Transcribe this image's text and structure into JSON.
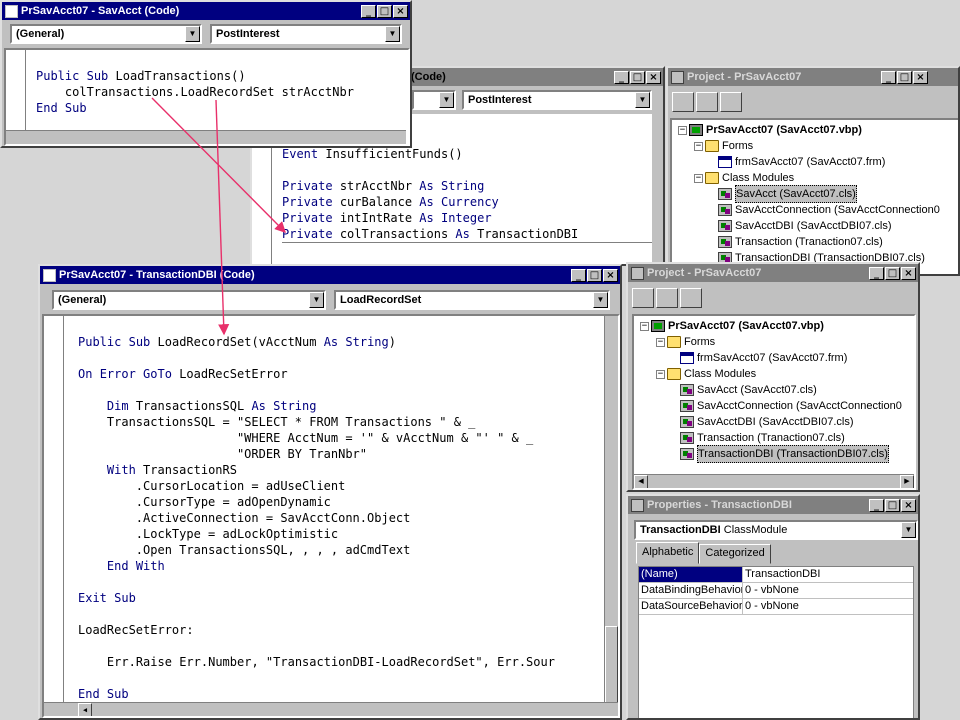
{
  "top_code_window": {
    "title": "PrSavAcct07 - SavAcct (Code)",
    "object_combo": "(General)",
    "proc_combo": "PostInterest",
    "lines": [
      "Public Sub LoadTransactions()",
      "    colTransactions.LoadRecordSet strAcctNbr",
      "End Sub"
    ]
  },
  "mid_code_window": {
    "title": "(Code)",
    "object_combo": "",
    "proc_combo": "PostInterest",
    "lines": [
      "Event InsufficientFunds()",
      "",
      "Private strAcctNbr As String",
      "Private curBalance As Currency",
      "Private intIntRate As Integer",
      "Private colTransactions As TransactionDBI"
    ]
  },
  "main_code_window": {
    "title": "PrSavAcct07 - TransactionDBI (Code)",
    "object_combo": "(General)",
    "proc_combo": "LoadRecordSet",
    "lines": [
      "Public Sub LoadRecordSet(vAcctNum As String)",
      "",
      "On Error GoTo LoadRecSetError",
      "",
      "    Dim TransactionsSQL As String",
      "    TransactionsSQL = \"SELECT * FROM Transactions \" & _",
      "                      \"WHERE AcctNum = '\" & vAcctNum & \"' \" & _",
      "                      \"ORDER BY TranNbr\"",
      "    With TransactionRS",
      "        .CursorLocation = adUseClient",
      "        .CursorType = adOpenDynamic",
      "        .ActiveConnection = SavAcctConn.Object",
      "        .LockType = adLockOptimistic",
      "        .Open TransactionsSQL, , , , adCmdText",
      "    End With",
      "",
      "Exit Sub",
      "",
      "LoadRecSetError:",
      "",
      "    Err.Raise Err.Number, \"TransactionDBI-LoadRecordSet\", Err.Sour",
      "",
      "End Sub"
    ]
  },
  "project_top": {
    "title": "Project - PrSavAcct07",
    "root": "PrSavAcct07 (SavAcct07.vbp)",
    "forms_label": "Forms",
    "form_item": "frmSavAcct07 (SavAcct07.frm)",
    "classes_label": "Class Modules",
    "class_items": [
      "SavAcct (SavAcct07.cls)",
      "SavAcctConnection (SavAcctConnection0",
      "SavAcctDBI (SavAcctDBI07.cls)",
      "Transaction (Tranaction07.cls)",
      "TransactionDBI (TransactionDBI07.cls)"
    ]
  },
  "project_bottom": {
    "title": "Project - PrSavAcct07",
    "root": "PrSavAcct07 (SavAcct07.vbp)",
    "forms_label": "Forms",
    "form_item": "frmSavAcct07 (SavAcct07.frm)",
    "classes_label": "Class Modules",
    "class_items": [
      "SavAcct (SavAcct07.cls)",
      "SavAcctConnection (SavAcctConnection0",
      "SavAcctDBI (SavAcctDBI07.cls)",
      "Transaction (Tranaction07.cls)",
      "TransactionDBI (TransactionDBI07.cls)"
    ]
  },
  "properties": {
    "title": "Properties - TransactionDBI",
    "object_name": "TransactionDBI",
    "object_type": "ClassModule",
    "tab_alphabetic": "Alphabetic",
    "tab_categorized": "Categorized",
    "rows": [
      {
        "name": "(Name)",
        "value": "TransactionDBI"
      },
      {
        "name": "DataBindingBehavior",
        "value": "0 - vbNone"
      },
      {
        "name": "DataSourceBehavior",
        "value": "0 - vbNone"
      }
    ]
  },
  "colors": {
    "keyword": "#00007f",
    "arrow": "#e8306a",
    "active_title": "#000080",
    "inactive_title": "#808080"
  }
}
